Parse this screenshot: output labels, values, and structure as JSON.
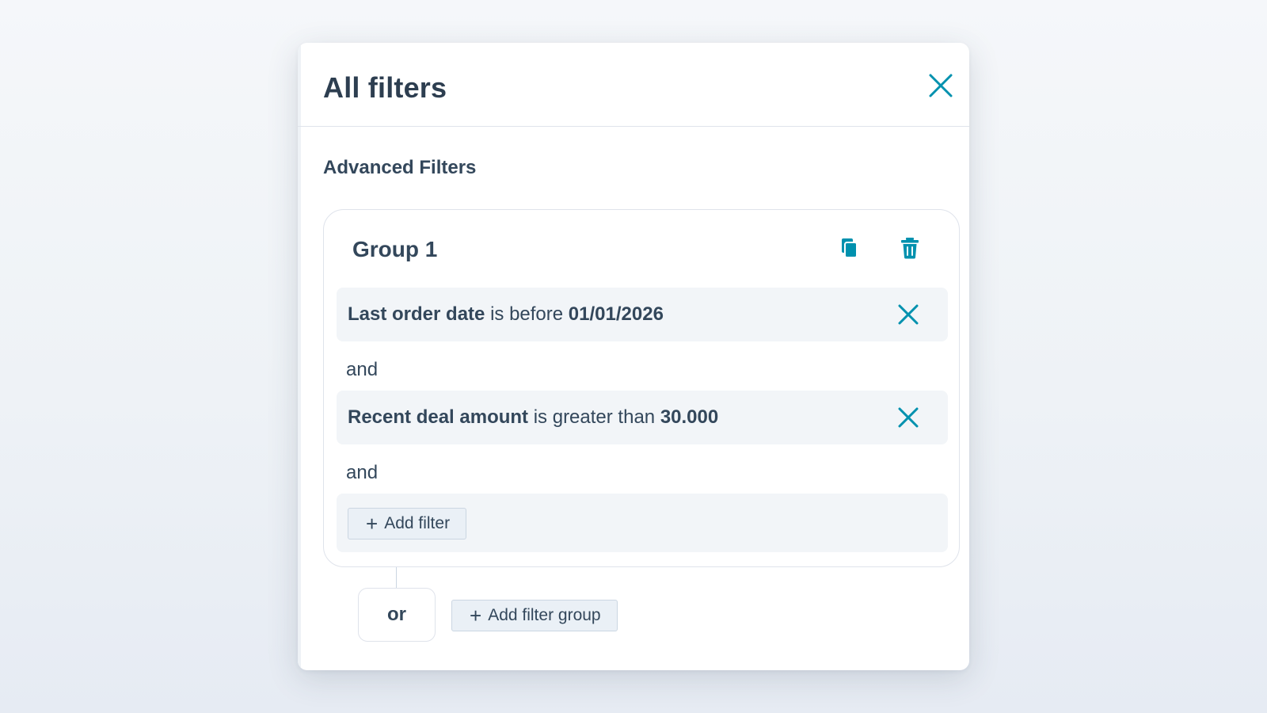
{
  "panel": {
    "title": "All filters",
    "close_icon": "close-icon"
  },
  "section": {
    "title": "Advanced Filters"
  },
  "group": {
    "title": "Group 1",
    "copy_icon": "copy-icon",
    "delete_icon": "trash-icon",
    "filters": [
      {
        "field": "Last order date",
        "operator": "is before",
        "value": "01/01/2026"
      },
      {
        "field": "Recent deal amount",
        "operator": "is greater than",
        "value": "30.000"
      }
    ],
    "joiners": [
      "and",
      "and"
    ],
    "add_filter_label": "Add filter",
    "add_icon": "plus-icon"
  },
  "footer": {
    "or_label": "or",
    "add_group_label": "Add filter group"
  },
  "colors": {
    "accent": "#0091ae",
    "text": "#33475b",
    "row_bg": "#f2f5f8",
    "button_bg": "#eaf0f6",
    "border": "#dfe3eb"
  }
}
